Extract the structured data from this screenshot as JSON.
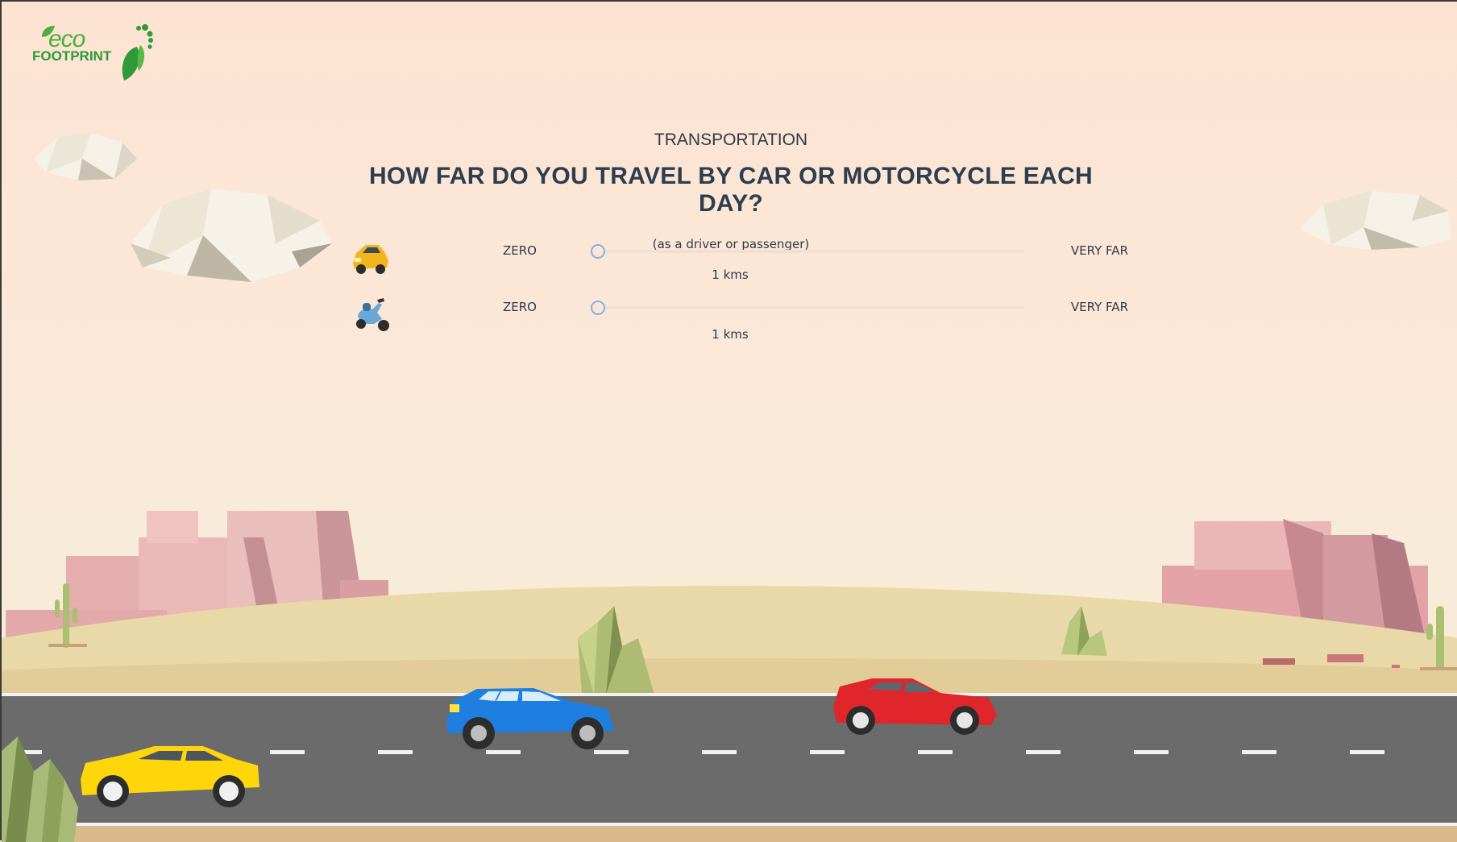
{
  "logo": {
    "eco": "eco",
    "footprint": "FOOTPRINT"
  },
  "section": {
    "category": "TRANSPORTATION",
    "question": "HOW FAR DO YOU TRAVEL BY CAR OR MOTORCYCLE EACH DAY?",
    "hint": "(as a driver or passenger)"
  },
  "sliders": [
    {
      "vehicle": "car",
      "icon": "car-icon",
      "min_label": "ZERO",
      "max_label": "VERY FAR",
      "value_text": "1 kms",
      "level": 0.0
    },
    {
      "vehicle": "motorcycle",
      "icon": "scooter-icon",
      "min_label": "ZERO",
      "max_label": "VERY FAR",
      "value_text": "1 kms",
      "level": 0.0
    }
  ],
  "colors": {
    "accent": "#7fb3e6",
    "title": "#2c3e50",
    "road": "#6b6b6b",
    "logo_green": "#2e9a3a"
  }
}
